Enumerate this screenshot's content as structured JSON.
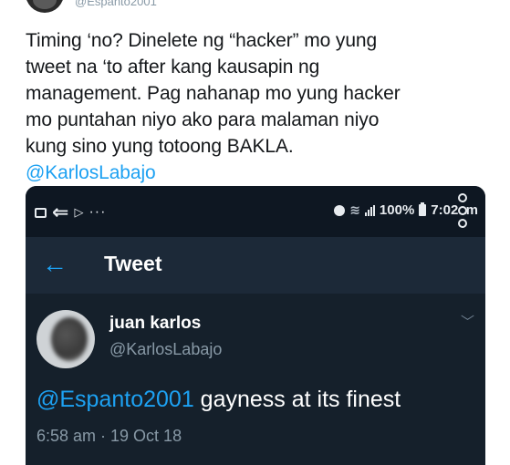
{
  "outer_tweet": {
    "handle": "@Espanto2001",
    "text_lines": [
      "Timing ‘no? Dinelete ng “hacker” mo yung",
      "tweet na ‘to after kang kausapin ng",
      "management. Pag nahanap mo yung hacker",
      "mo puntahan niyo ako para malaman niyo",
      "kung sino yung totoong BAKLA."
    ],
    "mention": "@KarlosLabajo"
  },
  "screenshot": {
    "status_bar": {
      "dots": "···",
      "battery_percent": "100%",
      "time": "7:02am",
      "icons": [
        "image-icon",
        "arrow-left-icon",
        "play-icon",
        "alarm-icon",
        "wifi-icon",
        "signal-icon",
        "battery-icon"
      ]
    },
    "app_bar": {
      "title": "Tweet"
    },
    "tweet": {
      "name": "juan karlos",
      "handle": "@KarlosLabajo",
      "mention": "@Espanto2001",
      "text": " gayness at its finest",
      "timestamp": "6:58 am · 19 Oct 18"
    }
  },
  "colors": {
    "link": "#1da1f2",
    "dark_bg": "#15202b",
    "app_bar_bg": "#1c2938",
    "text_primary": "#14171a",
    "text_secondary": "#8899a6"
  }
}
